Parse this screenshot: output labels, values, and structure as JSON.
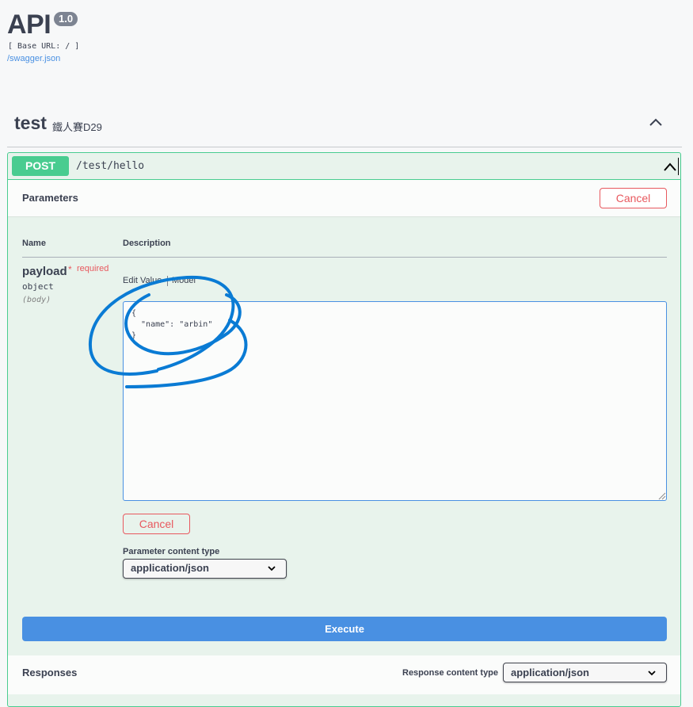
{
  "header": {
    "title": "API",
    "version": "1.0",
    "base_url": "[ Base URL: / ]",
    "spec_link": "/swagger.json"
  },
  "tag": {
    "name": "test",
    "description": "鐵人賽D29"
  },
  "operation": {
    "method": "POST",
    "path": "/test/hello",
    "method_color": "#49cc90"
  },
  "parameters": {
    "title": "Parameters",
    "cancel_label": "Cancel",
    "col_name": "Name",
    "col_description": "Description",
    "param": {
      "name": "payload",
      "required_star": "*",
      "required_label": "required",
      "type": "object",
      "in": "(body)"
    },
    "tabs": {
      "edit_value": "Edit Value",
      "model": "Model"
    },
    "body_value": "{\n  \"name\": \"arbin\"\n}",
    "cancel_inline_label": "Cancel",
    "content_type_label": "Parameter content type",
    "content_type_value": "application/json"
  },
  "execute_label": "Execute",
  "responses": {
    "title": "Responses",
    "content_type_label": "Response content type",
    "content_type_value": "application/json"
  },
  "colors": {
    "accent": "#4990e2",
    "danger": "#e8585e",
    "annotation": "#0a7bd4"
  }
}
